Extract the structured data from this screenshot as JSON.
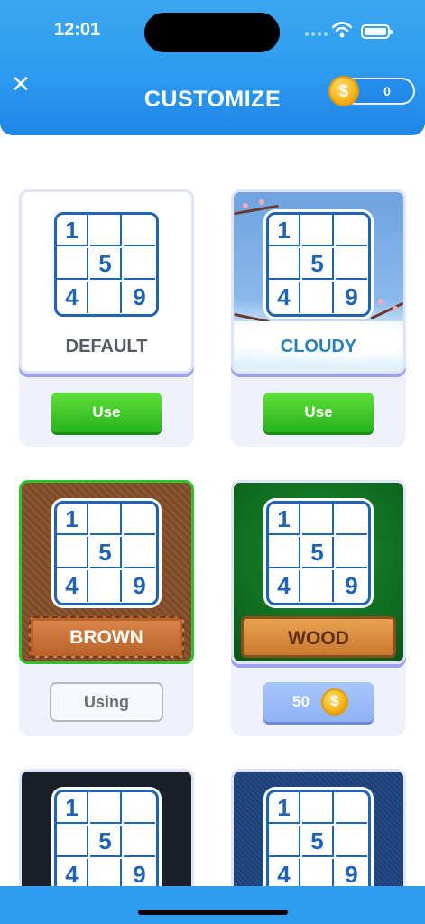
{
  "status_bar": {
    "time": "12:01"
  },
  "header": {
    "title": "CUSTOMIZE",
    "close_symbol": "✕",
    "coins": "0",
    "coin_symbol": "$"
  },
  "themes": [
    {
      "label": "DEFAULT",
      "action": "Use",
      "state": "available"
    },
    {
      "label": "CLOUDY",
      "action": "Use",
      "state": "available"
    },
    {
      "label": "BROWN",
      "action": "Using",
      "state": "in-use"
    },
    {
      "label": "WOOD",
      "action": "50",
      "state": "purchasable"
    },
    {
      "label": "",
      "action": "",
      "state": "partial"
    },
    {
      "label": "",
      "action": "",
      "state": "partial"
    }
  ],
  "board_sample": {
    "digits": [
      "1",
      "5",
      "4",
      "9"
    ]
  },
  "colors": {
    "header": "#2f9cf0",
    "use_button": "#27b41a",
    "selected_border": "#2bc42b",
    "grid": "#1f63b3"
  }
}
